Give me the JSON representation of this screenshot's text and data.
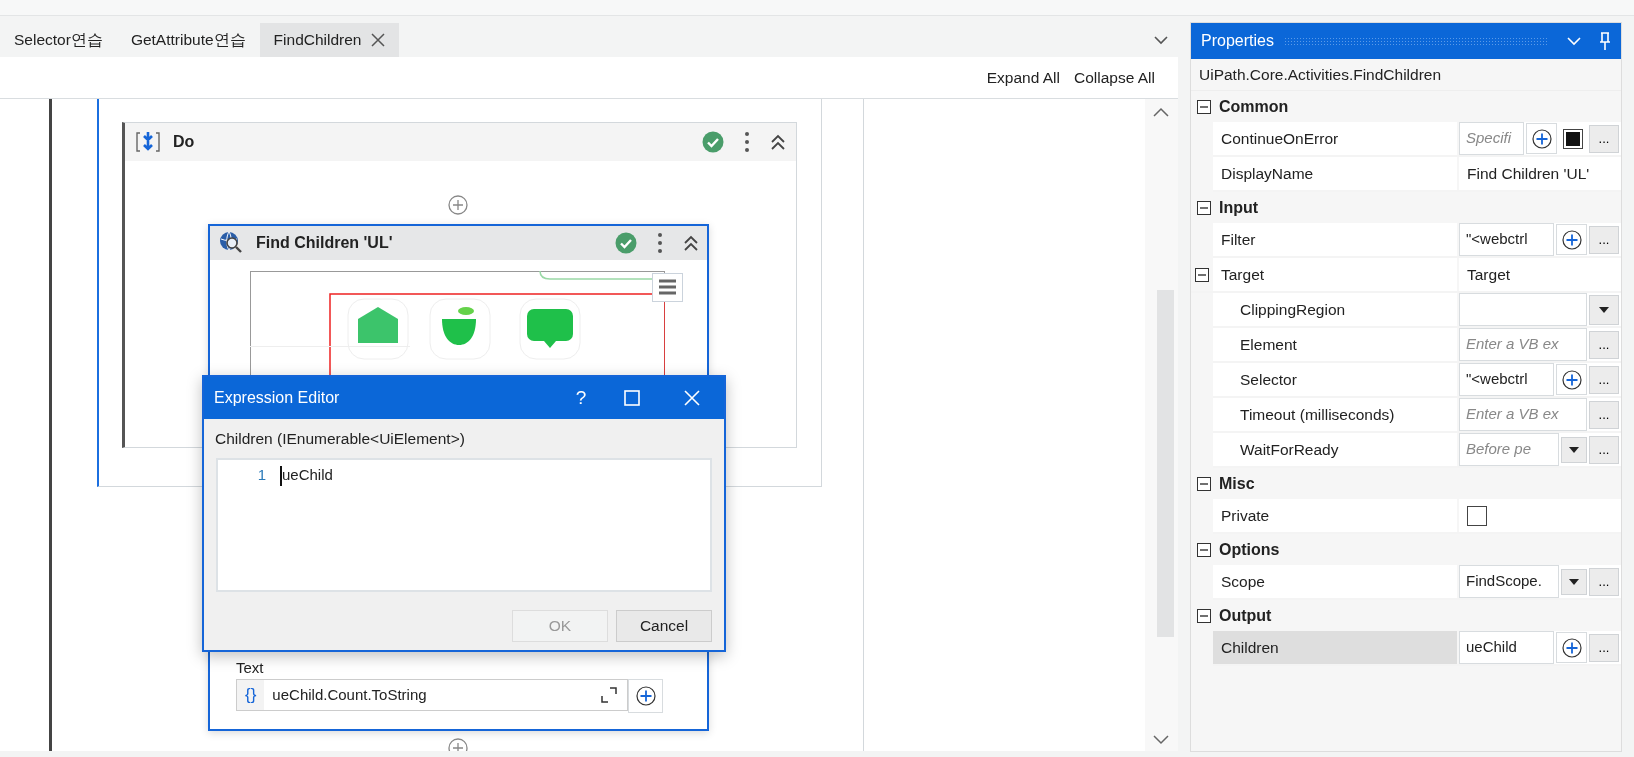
{
  "tabs": [
    {
      "label": "Selector연습",
      "selected": false
    },
    {
      "label": "GetAttribute연습",
      "selected": false
    },
    {
      "label": "FindChildren",
      "selected": true
    }
  ],
  "toolbar": [
    "Expand All",
    "Collapse All"
  ],
  "designer": {
    "sequence": {
      "selected": true
    },
    "do": {
      "title": "Do",
      "valid": true
    },
    "activity": {
      "title": "Find Children 'UL'",
      "valid": true,
      "selected": true,
      "field_label": "Text",
      "field_prefix": "{}",
      "field_value": "ueChild.Count.ToString"
    }
  },
  "dialog": {
    "title": "Expression Editor",
    "help": "?",
    "label": "Children (IEnumerable<UiElement>)",
    "lines": [
      {
        "number": "1",
        "code": "ueChild"
      }
    ],
    "buttons": [
      {
        "label": "OK",
        "disabled": true
      },
      {
        "label": "Cancel",
        "disabled": false
      }
    ]
  },
  "properties": {
    "title": "Properties",
    "type_name": "UiPath.Core.Activities.FindChildren",
    "categories": [
      {
        "name": "Common",
        "expanded": true,
        "rows": [
          {
            "name": "ContinueOnError",
            "kind": "flag_expression",
            "placeholder": "Specifi",
            "checked": true,
            "more": "...",
            "selected": false
          },
          {
            "name": "DisplayName",
            "kind": "text",
            "value": "Find Children 'UL'",
            "selected": false
          }
        ]
      },
      {
        "name": "Input",
        "expanded": true,
        "rows": [
          {
            "name": "Filter",
            "kind": "expression",
            "value": "\"<webctrl",
            "more": "...",
            "selected": false
          },
          {
            "name": "Target",
            "kind": "text",
            "value": "Target",
            "expanded": true,
            "selected": false,
            "children": [
              {
                "name": "ClippingRegion",
                "kind": "combo",
                "selected": false
              },
              {
                "name": "Element",
                "kind": "vb",
                "placeholder": "Enter a VB ex",
                "more": "...",
                "selected": false
              },
              {
                "name": "Selector",
                "kind": "expression",
                "value": "\"<webctrl",
                "more": "...",
                "selected": false
              },
              {
                "name": "Timeout (milliseconds)",
                "kind": "vb",
                "placeholder": "Enter a VB ex",
                "more": "...",
                "selected": false
              },
              {
                "name": "WaitForReady",
                "kind": "enum",
                "placeholder": "Before pe",
                "more": "...",
                "selected": false
              }
            ]
          }
        ]
      },
      {
        "name": "Misc",
        "expanded": true,
        "rows": [
          {
            "name": "Private",
            "kind": "checkbox",
            "checked": false,
            "selected": false
          }
        ]
      },
      {
        "name": "Options",
        "expanded": true,
        "rows": [
          {
            "name": "Scope",
            "kind": "enum",
            "value": "FindScope.",
            "more": "...",
            "selected": false
          }
        ]
      },
      {
        "name": "Output",
        "expanded": true,
        "rows": [
          {
            "name": "Children",
            "kind": "expression",
            "value": "ueChild",
            "more": "...",
            "selected": true
          }
        ]
      }
    ]
  }
}
